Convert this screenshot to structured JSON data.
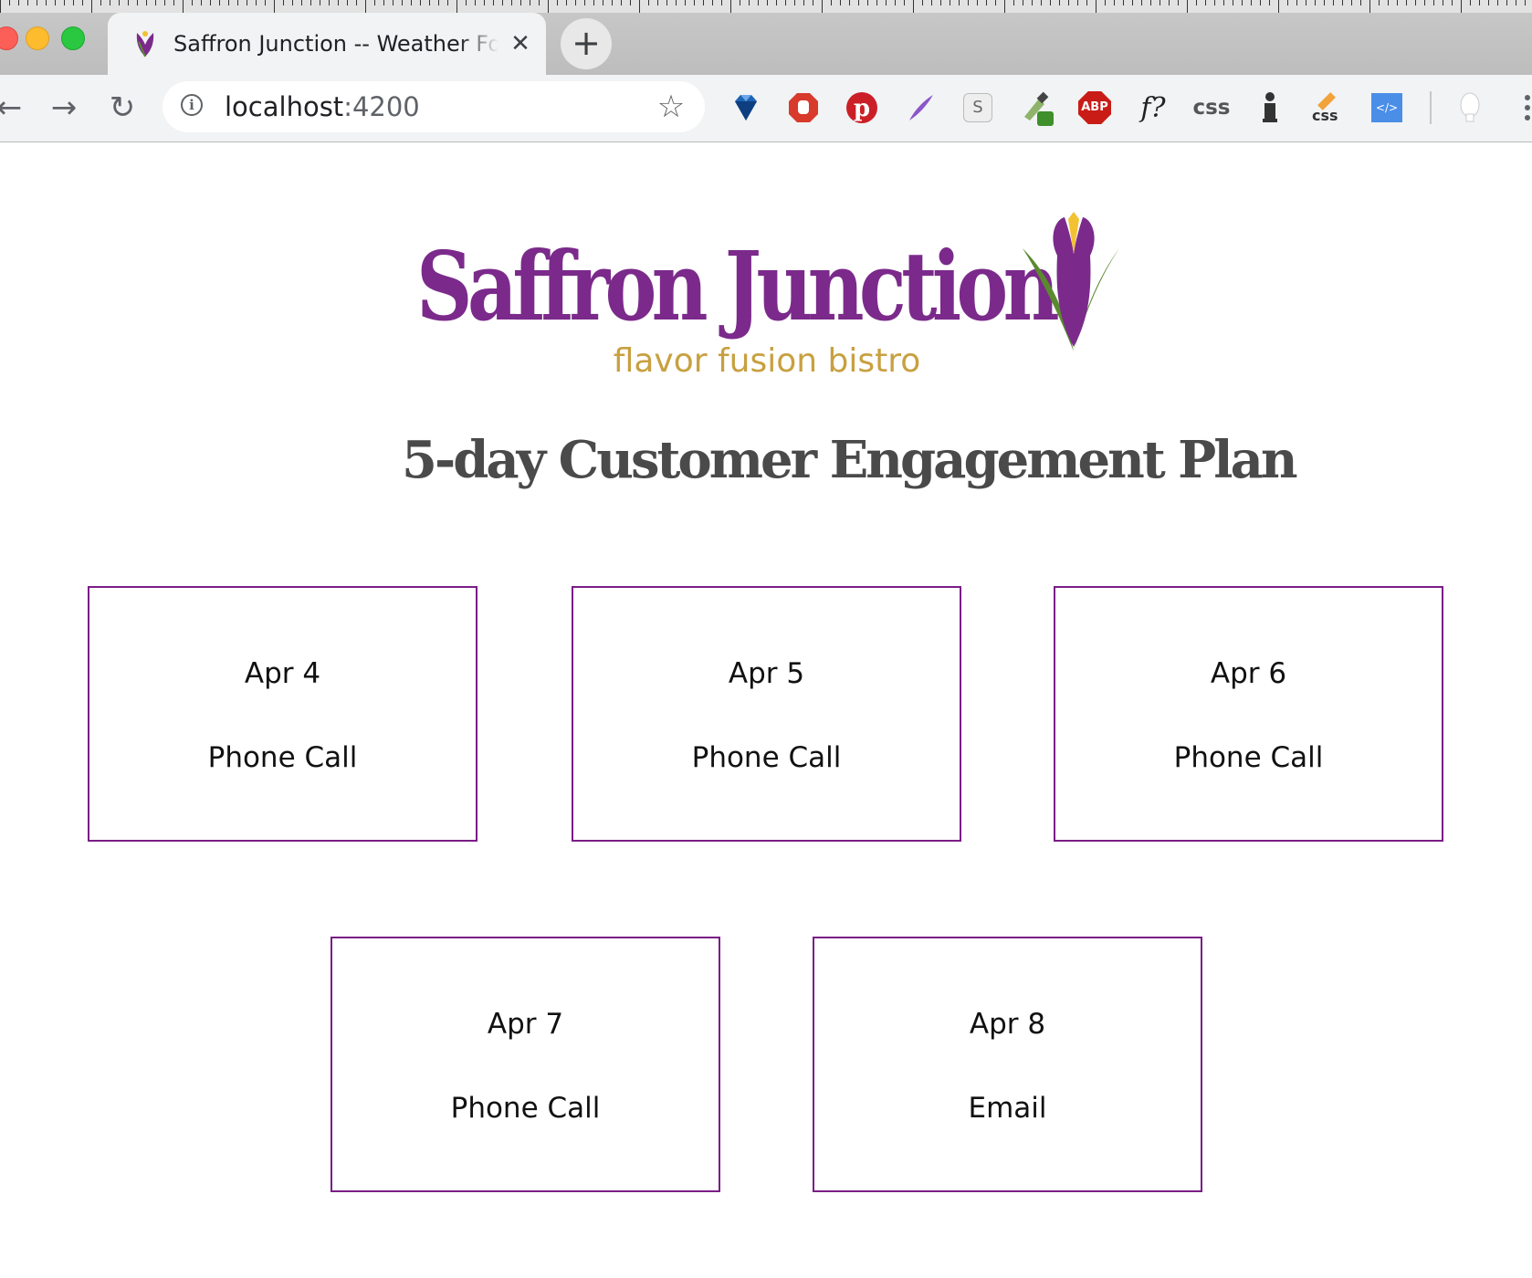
{
  "browser": {
    "tab": {
      "title": "Saffron Junction -- Weather Forecast"
    },
    "new_tab_label": "+",
    "address_bar": {
      "host": "localhost",
      "port": ":4200"
    },
    "extensions": [
      {
        "name": "diamond-extension-icon",
        "label": ""
      },
      {
        "name": "stop-hand-extension-icon",
        "label": ""
      },
      {
        "name": "pinterest-extension-icon",
        "label": ""
      },
      {
        "name": "quill-extension-icon",
        "label": ""
      },
      {
        "name": "s-extension-icon",
        "label": "S"
      },
      {
        "name": "eyedropper-extension-icon",
        "label": ""
      },
      {
        "name": "adblock-plus-extension-icon",
        "label": "ABP"
      },
      {
        "name": "font-finder-extension-icon",
        "label": "f?"
      },
      {
        "name": "css-viewer-extension-icon",
        "label": "css"
      },
      {
        "name": "info-person-extension-icon",
        "label": ""
      },
      {
        "name": "css-pencil-extension-icon",
        "label": "css"
      },
      {
        "name": "code-extension-icon",
        "label": "</>"
      },
      {
        "name": "profile-avatar-icon",
        "label": ""
      },
      {
        "name": "menu-kebab-icon",
        "label": ""
      }
    ]
  },
  "logo": {
    "name": "Saffron Junction",
    "tagline": "flavor fusion bistro",
    "colors": {
      "purple": "#7b2a8b",
      "gold": "#c8a040",
      "leaf": "#5a8a2e",
      "stamen": "#f2c233"
    }
  },
  "page": {
    "title": "5-day Customer Engagement Plan",
    "accent": "#7b1d87"
  },
  "plan": [
    {
      "date": "Apr 4",
      "action": "Phone Call"
    },
    {
      "date": "Apr 5",
      "action": "Phone Call"
    },
    {
      "date": "Apr 6",
      "action": "Phone Call"
    },
    {
      "date": "Apr 7",
      "action": "Phone Call"
    },
    {
      "date": "Apr 8",
      "action": "Email"
    }
  ]
}
